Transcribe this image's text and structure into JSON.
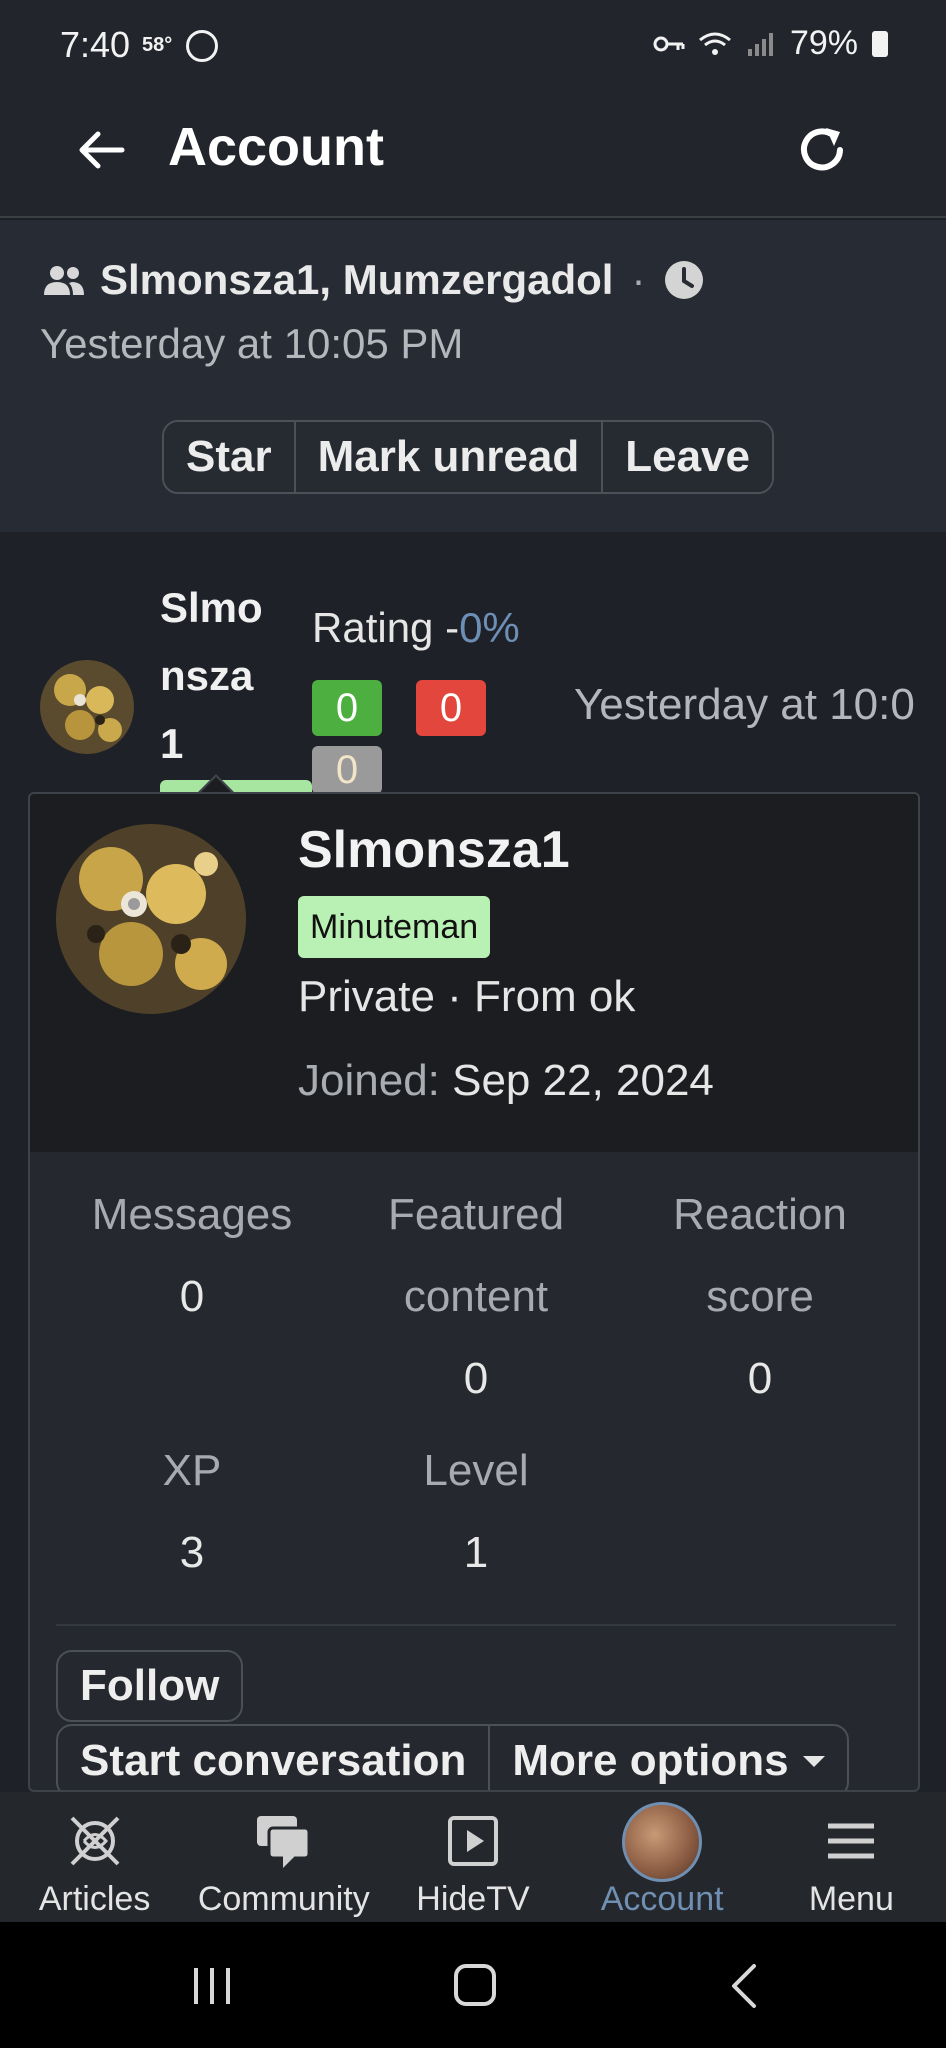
{
  "status_bar": {
    "time": "7:40",
    "temp": "58°",
    "battery": "79%"
  },
  "app_bar": {
    "title": "Account"
  },
  "conversation": {
    "participants": "Slmonsza1, Mumzergadol",
    "separator": "·",
    "date": "Yesterday at 10:05 PM",
    "actions": [
      "Star",
      "Mark unread",
      "Leave"
    ]
  },
  "message": {
    "username_lines": [
      "Slmo",
      "nsza",
      "1"
    ],
    "rating_label": "Rating -",
    "rating_value": "0%",
    "positive": "0",
    "negative": "0",
    "neutral": "0",
    "time": "Yesterday at 10:0"
  },
  "profile_card": {
    "name": "Slmonsza1",
    "badge": "Minuteman",
    "meta": "Private · From ok",
    "joined_label": "Joined:",
    "joined_value": " Sep 22, 2024",
    "stats": {
      "messages_label": "Messages",
      "messages_value": "0",
      "featured_label_1": "Featured",
      "featured_label_2": "content",
      "featured_value": "0",
      "reaction_label_1": "Reaction",
      "reaction_label_2": "score",
      "reaction_value": "0",
      "xp_label": "XP",
      "xp_value": "3",
      "level_label": "Level",
      "level_value": "1"
    },
    "follow": "Follow",
    "start_conversation": "Start conversation",
    "more_options": "More options"
  },
  "bottom_nav": {
    "items": [
      {
        "label": "Articles",
        "icon": "articles-icon"
      },
      {
        "label": "Community",
        "icon": "chat-bubbles-icon"
      },
      {
        "label": "HideTV",
        "icon": "play-icon"
      },
      {
        "label": "Account",
        "icon": "avatar"
      },
      {
        "label": "Menu",
        "icon": "menu-icon"
      }
    ],
    "active": "Account",
    "active_color": "#6f8fb3"
  }
}
